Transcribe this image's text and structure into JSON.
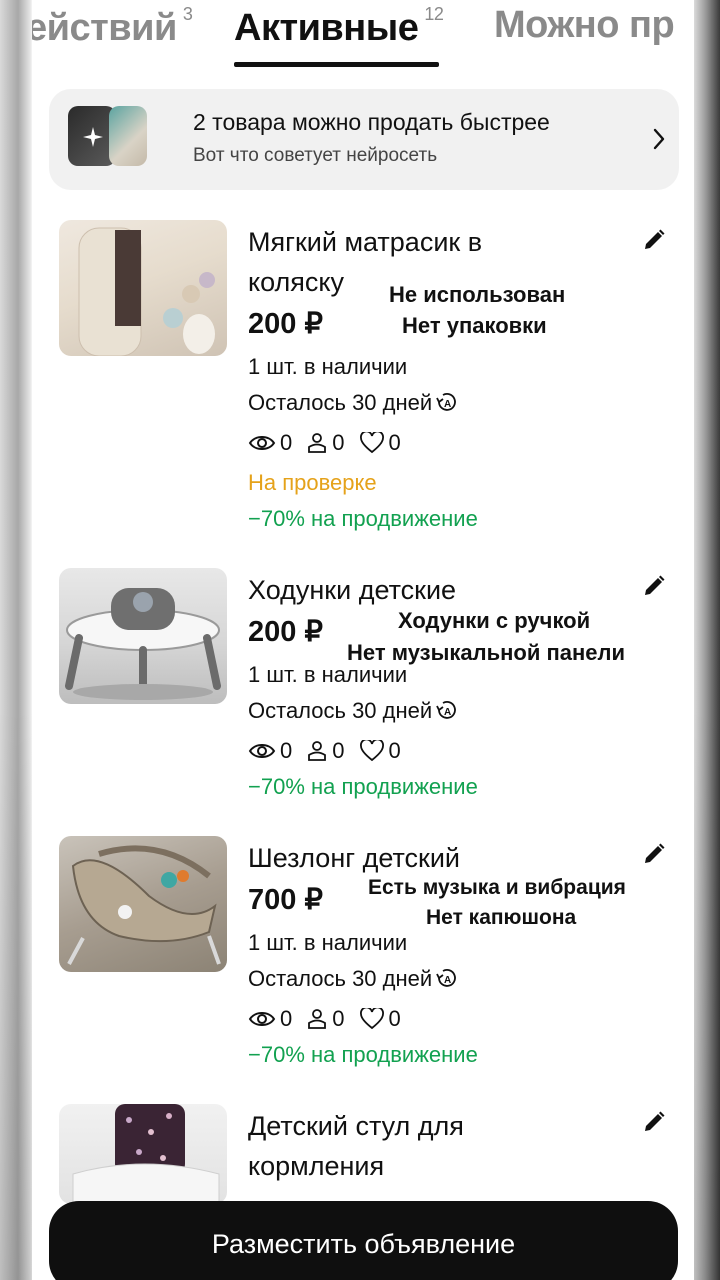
{
  "tabs": [
    {
      "label": "ействий",
      "count": "3"
    },
    {
      "label": "Активные",
      "count": "12"
    },
    {
      "label": "Можно пр",
      "count": ""
    }
  ],
  "banner": {
    "title": "2 товара можно продать быстрее",
    "subtitle": "Вот что советует нейросеть"
  },
  "listings": [
    {
      "title": "Мягкий матрасик в коляску",
      "price": "200 ₽",
      "stock": "1 шт. в наличии",
      "days_left": "Осталось 30 дней",
      "views": "0",
      "contacts": "0",
      "favorites": "0",
      "status": "На проверке",
      "promo": "−70% на продвижение",
      "note_lines": [
        "Не использован",
        "Нет упаковки"
      ]
    },
    {
      "title": "Ходунки детские",
      "price": "200 ₽",
      "stock": "1 шт. в наличии",
      "days_left": "Осталось 30 дней",
      "views": "0",
      "contacts": "0",
      "favorites": "0",
      "promo": "−70% на продвижение",
      "note_lines": [
        "Ходунки с ручкой",
        "Нет музыкальной панели"
      ]
    },
    {
      "title": "Шезлонг детский",
      "price": "700 ₽",
      "stock": "1 шт. в наличии",
      "days_left": "Осталось 30 дней",
      "views": "0",
      "contacts": "0",
      "favorites": "0",
      "promo": "−70% на продвижение",
      "note_lines": [
        "Есть музыка и вибрация",
        "Нет капюшона"
      ]
    },
    {
      "title": "Детский стул для кормления"
    }
  ],
  "cta_label": "Разместить объявление",
  "colors": {
    "status_pending": "#e5a21a",
    "promo_green": "#12a150",
    "cta_background": "#0f0f0f"
  }
}
